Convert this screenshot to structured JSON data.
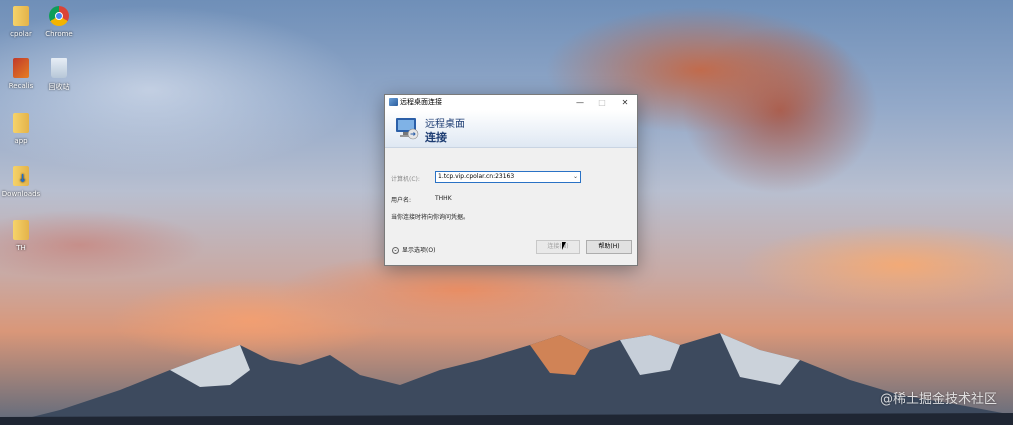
{
  "desktop": {
    "icons": [
      {
        "label": "cpolar",
        "icon": "folder-icon"
      },
      {
        "label": "Chrome",
        "icon": "chrome-icon"
      },
      {
        "label": "Recalis",
        "icon": "app-icon"
      },
      {
        "label": "回收站",
        "icon": "recycle-bin-icon"
      },
      {
        "label": "app",
        "icon": "folder-icon"
      },
      {
        "label": "Downloads",
        "icon": "downloads-icon"
      },
      {
        "label": "TH",
        "icon": "folder-icon"
      }
    ],
    "watermark": "@稀土掘金技术社区"
  },
  "dialog": {
    "title": "远程桌面连接",
    "header_line1": "远程桌面",
    "header_line2": "连接",
    "computer_label": "计算机(C):",
    "computer_value": "1.tcp.vip.cpolar.cn:23163",
    "username_label": "用户名:",
    "username_value": "THHK",
    "info_text": "当你连接时将向你询问凭据。",
    "show_options": "显示选项(O)",
    "connect_button": "连接(N)",
    "help_button": "帮助(H)",
    "controls": {
      "minimize": "—",
      "maximize": "□",
      "close": "✕"
    }
  },
  "colors": {
    "accent": "#2a72c5",
    "header_text": "#1e3d73"
  }
}
